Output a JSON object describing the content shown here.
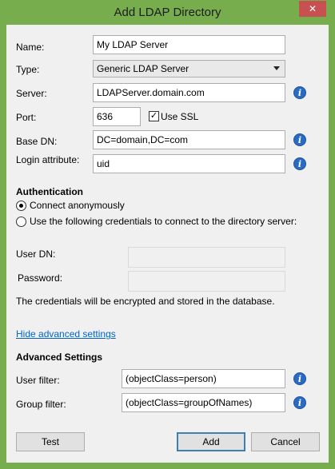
{
  "window": {
    "title": "Add LDAP Directory",
    "close_glyph": "✕"
  },
  "form": {
    "name": {
      "label": "Name:",
      "value": "My LDAP Server"
    },
    "type": {
      "label": "Type:",
      "value": "Generic LDAP Server"
    },
    "server": {
      "label": "Server:",
      "value": "LDAPServer.domain.com"
    },
    "port": {
      "label": "Port:",
      "value": "636"
    },
    "use_ssl": {
      "label": "Use SSL",
      "checked": true,
      "glyph": "✓"
    },
    "base_dn": {
      "label": "Base DN:",
      "value": "DC=domain,DC=com"
    },
    "login_attribute": {
      "label": "Login attribute:",
      "value": "uid"
    }
  },
  "authentication": {
    "heading": "Authentication",
    "option_anonymous": "Connect anonymously",
    "option_credentials": "Use the following credentials to connect to the directory server:",
    "selected": "anonymous",
    "user_dn_label": "User DN:",
    "password_label": "Password:",
    "note": "The credentials will be encrypted and stored in the database."
  },
  "advanced": {
    "toggle_link": "Hide advanced settings",
    "heading": "Advanced Settings",
    "user_filter": {
      "label": "User filter:",
      "value": "(objectClass=person)"
    },
    "group_filter": {
      "label": "Group filter:",
      "value": "(objectClass=groupOfNames)"
    }
  },
  "buttons": {
    "test": "Test",
    "add": "Add",
    "cancel": "Cancel"
  },
  "icons": {
    "info": "i"
  },
  "colors": {
    "titlebar": "#77ad4c",
    "close": "#c75050",
    "link": "#0066cc",
    "info": "#2a6bc2"
  }
}
